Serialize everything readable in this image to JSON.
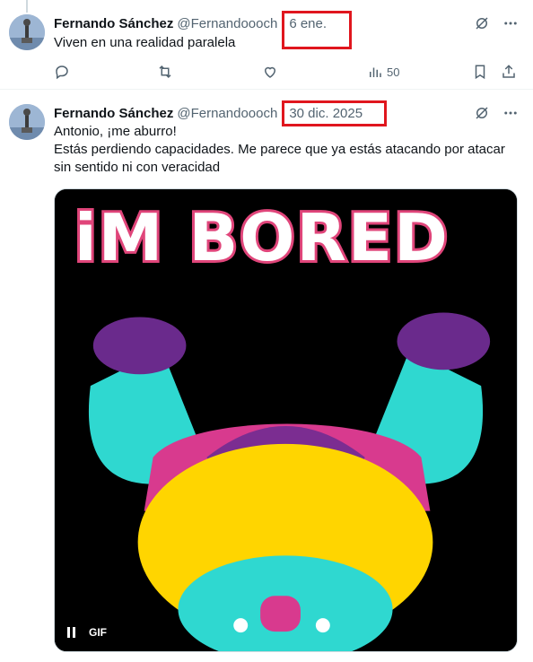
{
  "tweets": [
    {
      "author": "Fernando Sánchez",
      "handle": "@Fernandoooch",
      "separator": "·",
      "time": "6 ene.",
      "text": "Viven en una realidad paralela",
      "views": "50"
    },
    {
      "author": "Fernando Sánchez",
      "handle": "@Fernandoooch",
      "separator": "·",
      "time": "30 dic. 2025",
      "text_lines": [
        "Antonio, ¡me aburro!",
        "Estás perdiendo capacidades. Me parece que ya estás atacando por atacar",
        "sin sentido ni con veracidad"
      ],
      "media": {
        "type": "gif",
        "overlay_text": "iM BORED",
        "gif_badge": "GIF"
      }
    }
  ],
  "icons": {
    "grok": "grok-icon",
    "more": "more-icon",
    "reply": "reply-icon",
    "retweet": "retweet-icon",
    "like": "like-icon",
    "views": "views-icon",
    "bookmark": "bookmark-icon",
    "share": "share-icon"
  },
  "colors": {
    "highlight": "#e0161e",
    "text_primary": "#0f1419",
    "text_secondary": "#536471",
    "divider": "#eff3f4"
  }
}
